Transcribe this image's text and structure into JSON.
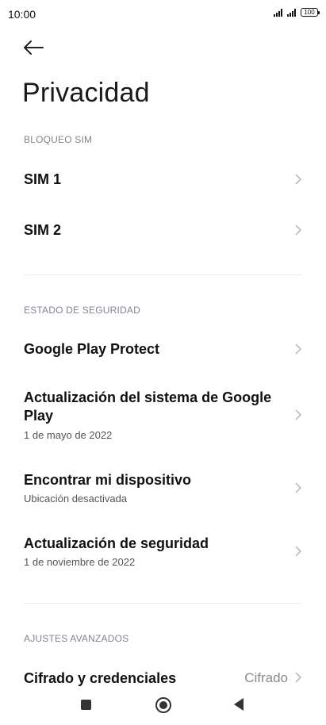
{
  "status_bar": {
    "time": "10:00",
    "battery": "100"
  },
  "header": {
    "title": "Privacidad"
  },
  "sections": {
    "sim": {
      "header": "BLOQUEO SIM",
      "items": [
        {
          "title": "SIM 1"
        },
        {
          "title": "SIM 2"
        }
      ]
    },
    "security": {
      "header": "ESTADO DE SEGURIDAD",
      "items": [
        {
          "title": "Google Play Protect"
        },
        {
          "title": "Actualización del sistema de Google Play",
          "subtitle": "1 de mayo de 2022"
        },
        {
          "title": "Encontrar mi dispositivo",
          "subtitle": "Ubicación desactivada"
        },
        {
          "title": "Actualización de seguridad",
          "subtitle": "1 de noviembre de 2022"
        }
      ]
    },
    "advanced": {
      "header": "AJUSTES AVANZADOS",
      "items": [
        {
          "title": "Cifrado y credenciales",
          "value": "Cifrado"
        }
      ]
    }
  },
  "icons": {
    "back": "arrow-left-icon",
    "chevron": "chevron-right-icon",
    "nav_recents": "square-icon",
    "nav_home": "circle-icon",
    "nav_back": "triangle-back-icon"
  }
}
